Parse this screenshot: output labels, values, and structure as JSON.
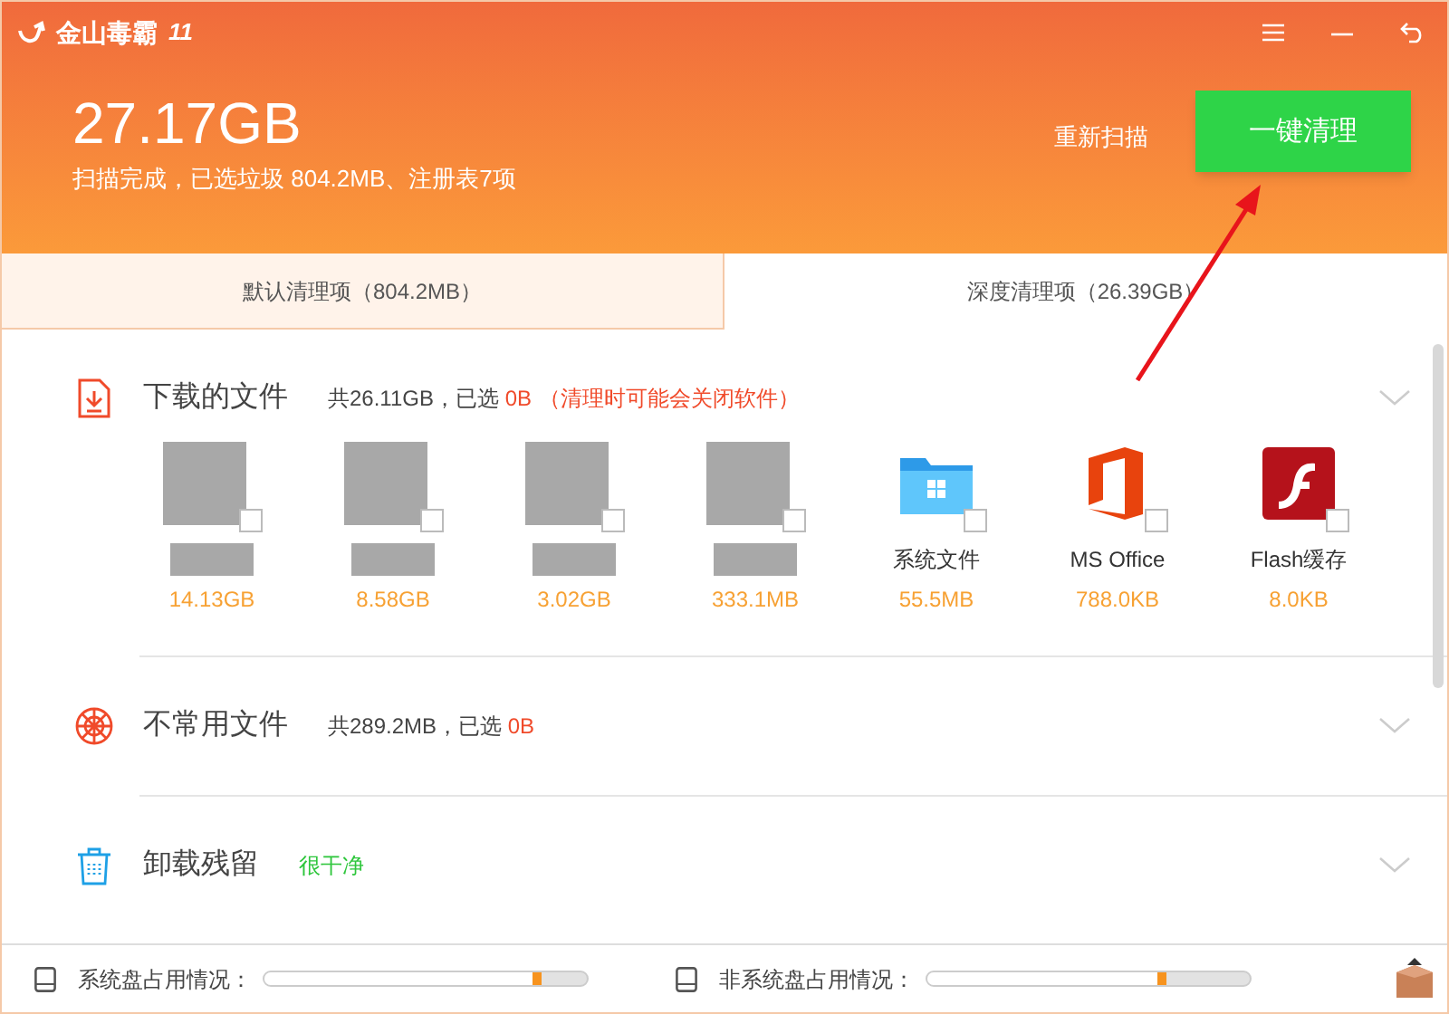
{
  "app": {
    "title": "金山毒霸",
    "version": "11"
  },
  "header": {
    "size": "27.17GB",
    "summary": "扫描完成，已选垃圾 804.2MB、注册表7项",
    "rescan": "重新扫描",
    "clean_button": "一键清理"
  },
  "tabs": [
    {
      "label": "默认清理项（804.2MB）",
      "selected": true
    },
    {
      "label": "深度清理项（26.39GB）",
      "selected": false
    }
  ],
  "sections": [
    {
      "kind": "download",
      "title": "下载的文件",
      "total": "共26.11GB，已选",
      "selected_size": "0B",
      "warning": "（清理时可能会关闭软件）",
      "items": [
        {
          "kind": "redacted",
          "size": "14.13GB",
          "checked": false
        },
        {
          "kind": "redacted",
          "size": "8.58GB",
          "checked": false
        },
        {
          "kind": "redacted",
          "size": "3.02GB",
          "checked": false
        },
        {
          "kind": "redacted",
          "size": "333.1MB",
          "checked": false
        },
        {
          "kind": "folder",
          "label": "系统文件",
          "size": "55.5MB",
          "checked": false
        },
        {
          "kind": "office",
          "label": "MS Office",
          "size": "788.0KB",
          "checked": false
        },
        {
          "kind": "flash",
          "label": "Flash缓存",
          "size": "8.0KB",
          "checked": false
        }
      ]
    },
    {
      "kind": "web",
      "title": "不常用文件",
      "total": "共289.2MB，已选",
      "selected_size": "0B"
    },
    {
      "kind": "trash",
      "title": "卸载残留",
      "status": "很干净"
    }
  ],
  "footer": {
    "disks": [
      {
        "label": "系统盘占用情况：",
        "level": 0.86
      },
      {
        "label": "非系统盘占用情况：",
        "level": 0.74
      }
    ]
  }
}
